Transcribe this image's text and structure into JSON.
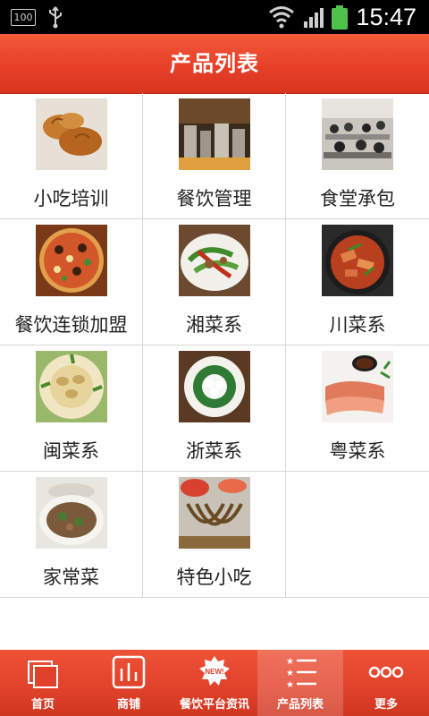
{
  "status_bar": {
    "battery_level": "100",
    "time": "15:47"
  },
  "header": {
    "title": "产品列表"
  },
  "products": [
    {
      "label": "小吃培训",
      "image": "fried-chicken"
    },
    {
      "label": "餐饮管理",
      "image": "restaurant-kitchen"
    },
    {
      "label": "食堂承包",
      "image": "canteen-dining"
    },
    {
      "label": "餐饮连锁加盟",
      "image": "pizza"
    },
    {
      "label": "湘菜系",
      "image": "hunan-dish"
    },
    {
      "label": "川菜系",
      "image": "sichuan-dish"
    },
    {
      "label": "闽菜系",
      "image": "fujian-dish"
    },
    {
      "label": "浙菜系",
      "image": "zhejiang-dish"
    },
    {
      "label": "粤菜系",
      "image": "cantonese-dish"
    },
    {
      "label": "家常菜",
      "image": "home-style-dish"
    },
    {
      "label": "特色小吃",
      "image": "noodle-snack"
    }
  ],
  "tab_bar": {
    "tabs": [
      {
        "label": "首页",
        "icon": "home-icon"
      },
      {
        "label": "商铺",
        "icon": "shop-icon"
      },
      {
        "label": "餐饮平台资讯",
        "icon": "news-icon",
        "badge": "NEW!"
      },
      {
        "label": "产品列表",
        "icon": "list-icon",
        "active": true
      },
      {
        "label": "更多",
        "icon": "more-icon"
      }
    ]
  }
}
